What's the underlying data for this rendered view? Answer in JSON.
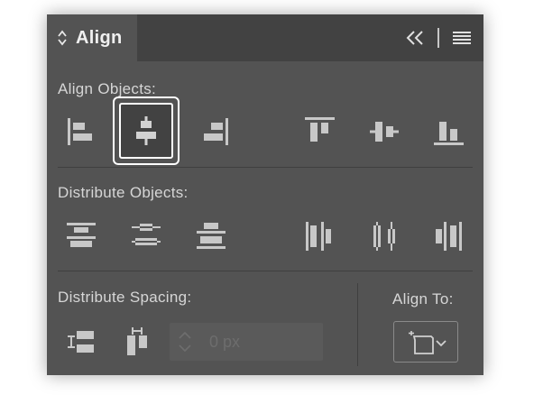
{
  "panel": {
    "tab_title": "Align",
    "icons": {
      "tab": "updown-arrows-icon",
      "collapse": "double-chevron-left-icon",
      "menu": "hamburger-menu-icon"
    }
  },
  "align_objects": {
    "label": "Align Objects:",
    "buttons": [
      {
        "name": "horizontal-align-left-icon",
        "selected": false
      },
      {
        "name": "horizontal-align-center-icon",
        "selected": true
      },
      {
        "name": "horizontal-align-right-icon",
        "selected": false
      },
      {
        "name": "vertical-align-top-icon",
        "selected": false
      },
      {
        "name": "vertical-align-center-icon",
        "selected": false
      },
      {
        "name": "vertical-align-bottom-icon",
        "selected": false
      }
    ]
  },
  "distribute_objects": {
    "label": "Distribute Objects:",
    "buttons": [
      {
        "name": "vertical-distribute-top-icon"
      },
      {
        "name": "vertical-distribute-center-icon"
      },
      {
        "name": "vertical-distribute-bottom-icon"
      },
      {
        "name": "horizontal-distribute-left-icon"
      },
      {
        "name": "horizontal-distribute-center-icon"
      },
      {
        "name": "horizontal-distribute-right-icon"
      }
    ]
  },
  "distribute_spacing": {
    "label": "Distribute Spacing:",
    "buttons": [
      {
        "name": "vertical-distribute-space-icon"
      },
      {
        "name": "horizontal-distribute-space-icon"
      }
    ],
    "spacing_value": "",
    "spacing_placeholder": "0 px"
  },
  "align_to": {
    "label": "Align To:",
    "icon": "align-to-selection-icon"
  },
  "colors": {
    "panel_bg": "#535353",
    "tabbar_bg": "#424242",
    "icon_fill": "#c8c8c8",
    "text": "#d6d6d6",
    "selection_outline": "#ffffff"
  }
}
